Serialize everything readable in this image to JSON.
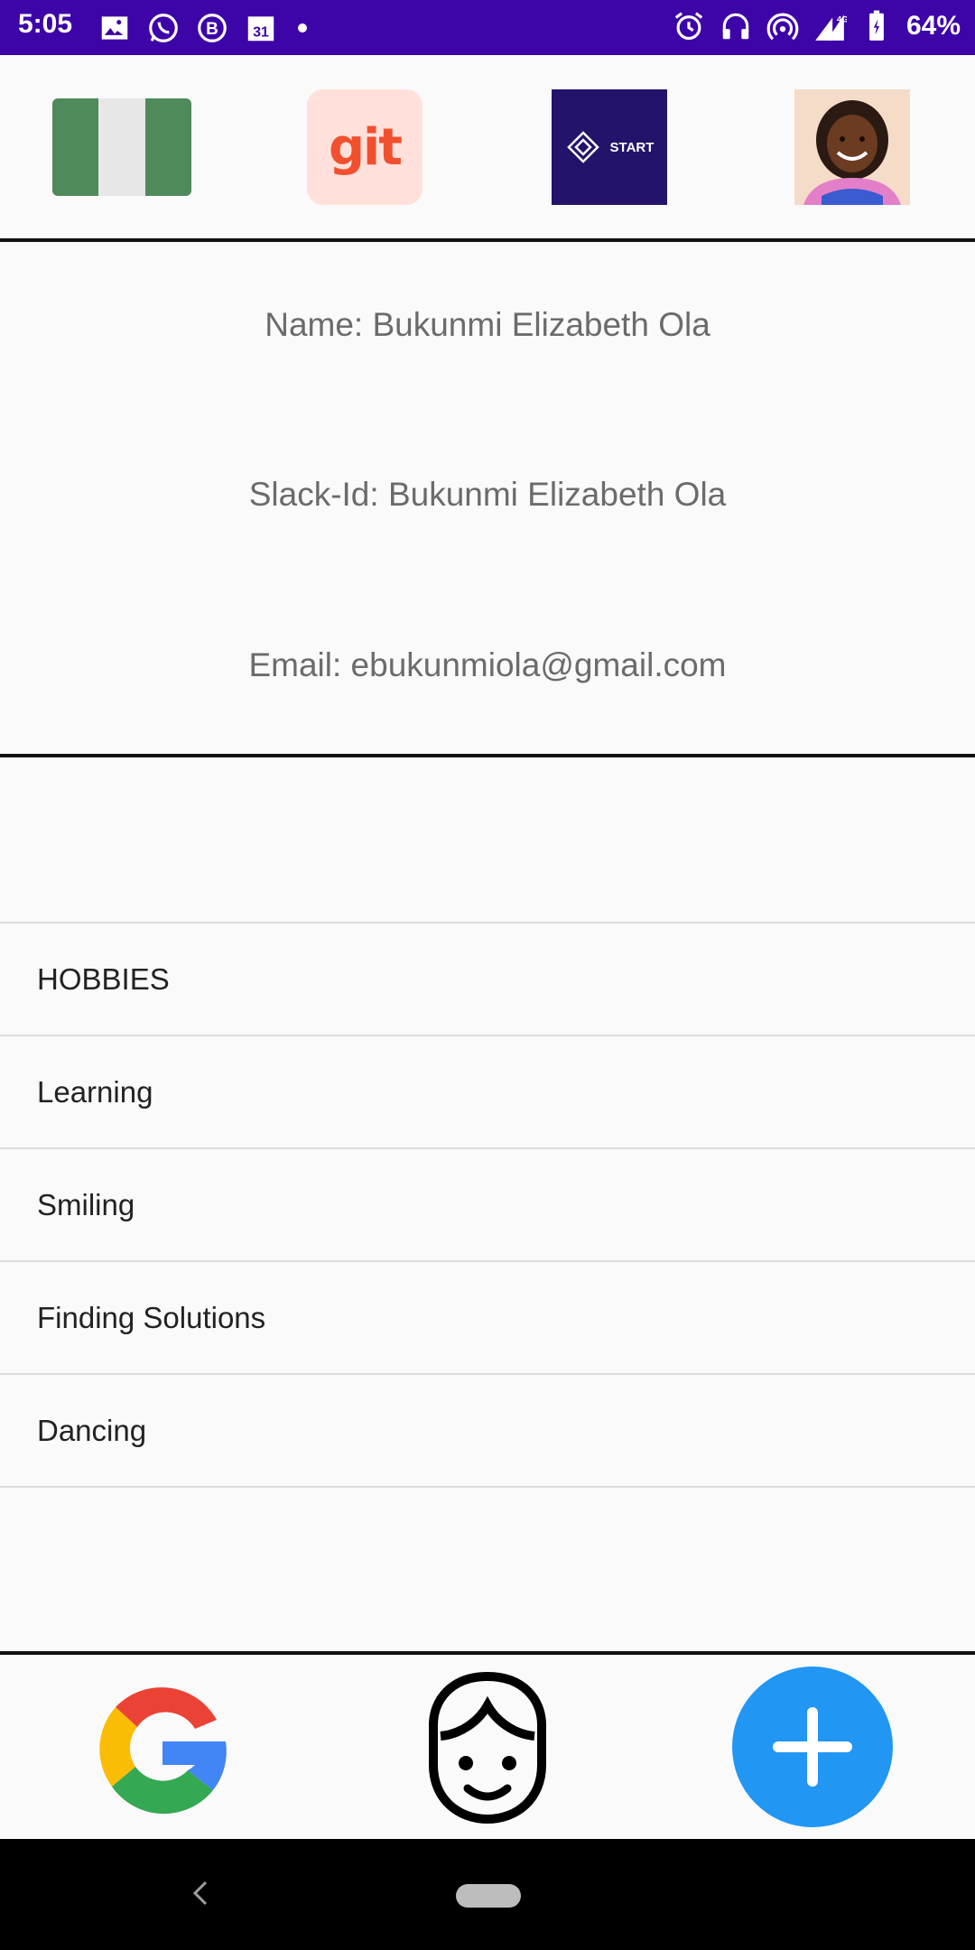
{
  "status_bar": {
    "time": "5:05",
    "battery": "64%",
    "network": "4G",
    "icons_left": [
      "image-icon",
      "whatsapp-icon",
      "b-icon",
      "calendar-icon",
      "dot-icon"
    ],
    "icons_right": [
      "alarm-icon",
      "headphones-icon",
      "hotspot-icon",
      "signal-icon",
      "battery-icon"
    ],
    "background": "#3d04a8"
  },
  "top_icons": {
    "flag": "nigeria-flag-icon",
    "git_label": "git",
    "start_label": "START",
    "avatar": "profile-photo"
  },
  "info": {
    "name": "Name: Bukunmi Elizabeth Ola",
    "slack": "Slack-Id: Bukunmi Elizabeth Ola",
    "email": "Email: ebukunmiola@gmail.com"
  },
  "hobbies": {
    "header": "HOBBIES",
    "items": [
      "Learning",
      "Smiling",
      "Finding Solutions",
      "Dancing"
    ]
  },
  "bottom_bar": {
    "icons": [
      "google-icon",
      "face-icon",
      "add-icon"
    ],
    "add_color": "#2196f3"
  },
  "colors": {
    "flag_green": "#4f8a5b",
    "git_orange": "#f1502f",
    "start_bg": "#25126b"
  }
}
